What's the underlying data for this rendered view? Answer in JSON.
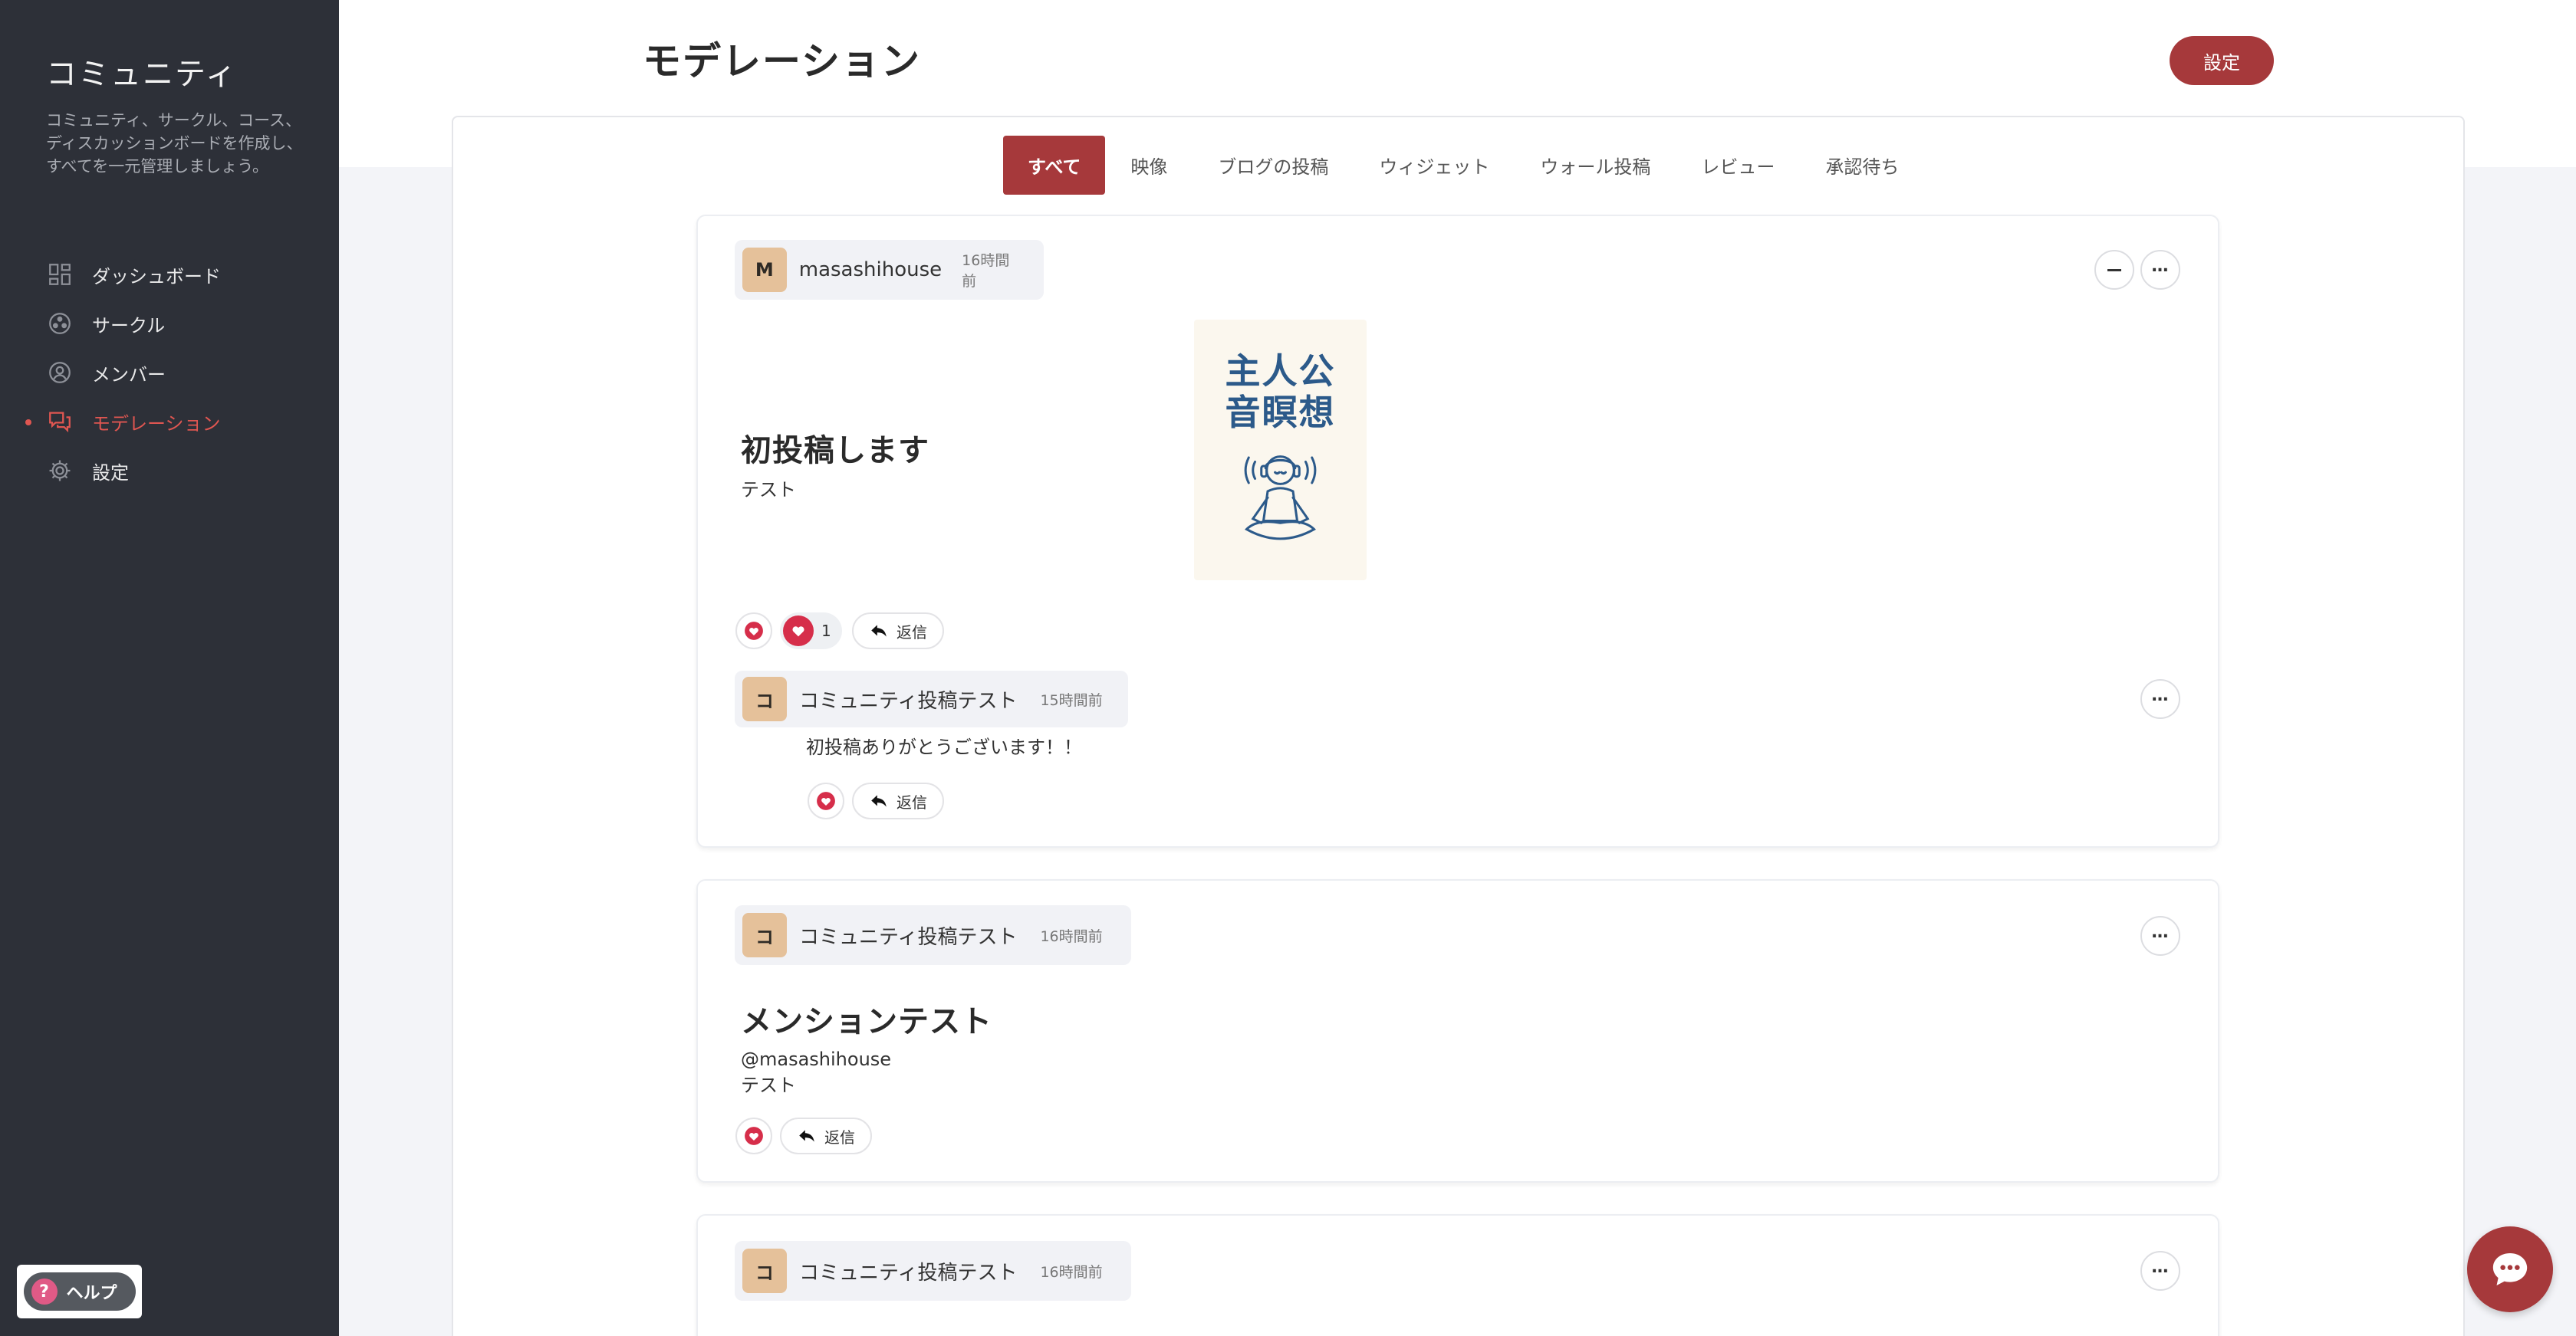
{
  "sidebar": {
    "title": "コミュニティ",
    "description": "コミュニティ、サークル、コース、ディスカッションボードを作成し、すべてを一元管理しましょう。",
    "items": [
      {
        "label": "ダッシュボード",
        "icon": "dashboard-icon"
      },
      {
        "label": "サークル",
        "icon": "circle-group-icon"
      },
      {
        "label": "メンバー",
        "icon": "member-icon"
      },
      {
        "label": "モデレーション",
        "icon": "moderation-icon",
        "active": true
      },
      {
        "label": "設定",
        "icon": "gear-icon"
      }
    ],
    "help_label": "ヘルプ",
    "help_glyph": "?"
  },
  "header": {
    "title": "モデレーション",
    "settings_label": "設定"
  },
  "tabs": [
    {
      "label": "すべて",
      "active": true
    },
    {
      "label": "映像"
    },
    {
      "label": "ブログの投稿"
    },
    {
      "label": "ウィジェット"
    },
    {
      "label": "ウォール投稿"
    },
    {
      "label": "レビュー"
    },
    {
      "label": "承認待ち"
    }
  ],
  "posts": [
    {
      "avatar": "M",
      "author": "masashihouse",
      "time": "16時間前",
      "title": "初投稿します",
      "body": "テスト",
      "image_text": "主人公\n音瞑想",
      "like_count": "1",
      "reply_label": "返信",
      "comment": {
        "avatar": "コ",
        "author": "コミュニティ投稿テスト",
        "time": "15時間前",
        "body": "初投稿ありがとうございます！！",
        "reply_label": "返信"
      }
    },
    {
      "avatar": "コ",
      "author": "コミュニティ投稿テスト",
      "time": "16時間前",
      "title": "メンションテスト",
      "mention": "@masashihouse",
      "body": "テスト",
      "reply_label": "返信"
    },
    {
      "avatar": "コ",
      "author": "コミュニティ投稿テスト",
      "time": "16時間前"
    }
  ],
  "colors": {
    "accent": "#a6393b",
    "sidebar_bg": "#2d3038",
    "active_nav": "#e05651",
    "heart": "#d62e4a"
  }
}
